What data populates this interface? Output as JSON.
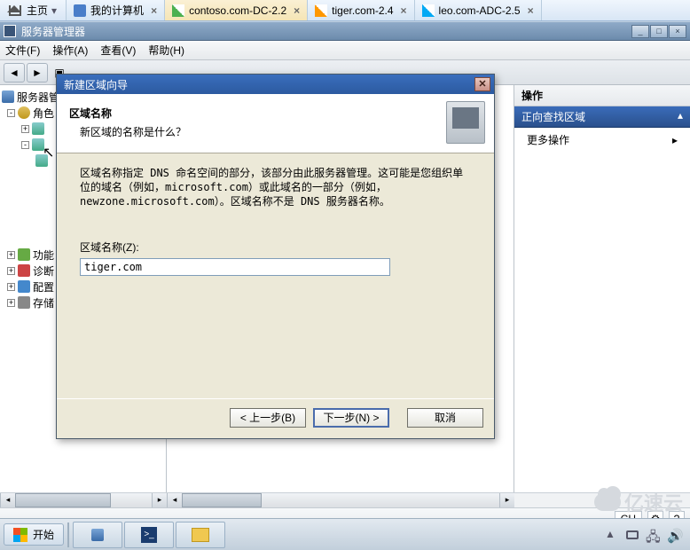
{
  "browser": {
    "home_label": "主页",
    "tabs": [
      {
        "label": "我的计算机",
        "icon": "pc"
      },
      {
        "label": "contoso.com-DC-2.2",
        "icon": "server1",
        "active": true
      },
      {
        "label": "tiger.com-2.4",
        "icon": "server2"
      },
      {
        "label": "leo.com-ADC-2.5",
        "icon": "server3"
      }
    ]
  },
  "window": {
    "title": "服务器管理器"
  },
  "menu": {
    "file": "文件(F)",
    "action": "操作(A)",
    "view": "查看(V)",
    "help": "帮助(H)"
  },
  "tree": {
    "root": "服务器管理器",
    "roles": "角色",
    "func": "功能",
    "diag": "诊断",
    "conf": "配置",
    "stor": "存储"
  },
  "actions": {
    "header": "操作",
    "sub_header": "正向查找区域",
    "more": "更多操作"
  },
  "dialog": {
    "title": "新建区域向导",
    "header_title": "区域名称",
    "header_sub": "新区域的名称是什么？",
    "description": "区域名称指定 DNS 命名空间的部分，该部分由此服务器管理。这可能是您组织单位的域名（例如，microsoft.com）或此域名的一部分（例如，newzone.microsoft.com）。区域名称不是 DNS 服务器名称。",
    "field_label": "区域名称(Z):",
    "field_value": "tiger.com",
    "btn_back": "< 上一步(B)",
    "btn_next": "下一步(N) >",
    "btn_cancel": "取消"
  },
  "status": {
    "ch": "CH"
  },
  "taskbar": {
    "start": "开始"
  },
  "watermark": "亿速云"
}
